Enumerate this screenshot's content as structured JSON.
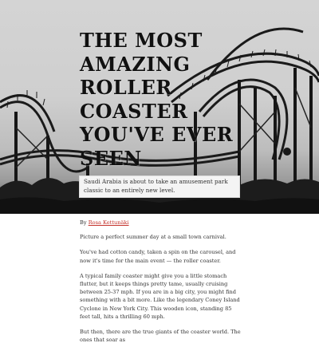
{
  "hero": {
    "title_lines": [
      "THE MOST",
      "AMAZING",
      "ROLLER",
      "COASTER",
      "YOU'VE EVER",
      "SEEN"
    ],
    "subtitle": "Saudi Arabia is about to take an amusement park classic to an entirely new level."
  },
  "byline": {
    "prefix": "By",
    "author": "Rosa Kettunäki"
  },
  "article": {
    "paragraphs": [
      "Picture a perfect summer day at a small town carnival.",
      "You've had cotton candy, taken a spin on the carousel, and now it's time for the main event — the roller coaster.",
      "A typical family coaster might give you a little stomach flutter, but it keeps things pretty tame, usually cruising between 25-37 mph. If you are in a big city, you might find something with a bit more. Like the legendary Coney Island Cyclone in New York City. This wooden icon, standing 85 feet tall, hits a thrilling 60 mph.",
      "But then, there are the true giants of the coaster world. The ones that soar as"
    ]
  }
}
